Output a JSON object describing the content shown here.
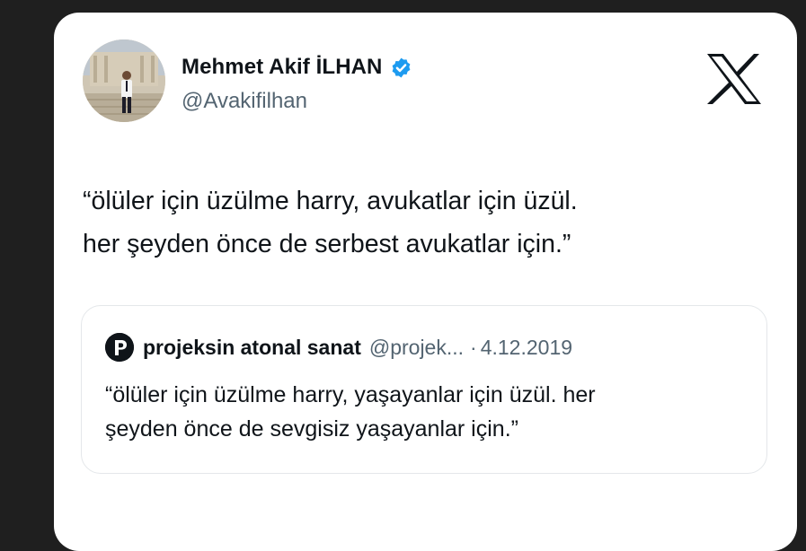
{
  "tweet": {
    "author": {
      "name": "Mehmet Akif İLHAN",
      "handle": "@Avakifilhan",
      "verified": true,
      "verified_color": "#1d9bf0"
    },
    "platform_icon": "x-logo-icon",
    "text": "“ölüler için üzülme harry, avukatlar için üzül.\nher şeyden önce de serbest avukatlar için.”"
  },
  "quoted_tweet": {
    "author_name": "projeksin atonal sanat",
    "handle": "@projek...",
    "separator": "·",
    "date": "4.12.2019",
    "avatar_icon": "p-logo-icon",
    "text": "“ölüler için üzülme harry, yaşayanlar için üzül. her\nşeyden önce de sevgisiz yaşayanlar için.”"
  },
  "colors": {
    "background": "#1f1f1f",
    "card": "#ffffff",
    "text_primary": "#0f1419",
    "text_secondary": "#536471",
    "border": "#e4e7ea"
  }
}
